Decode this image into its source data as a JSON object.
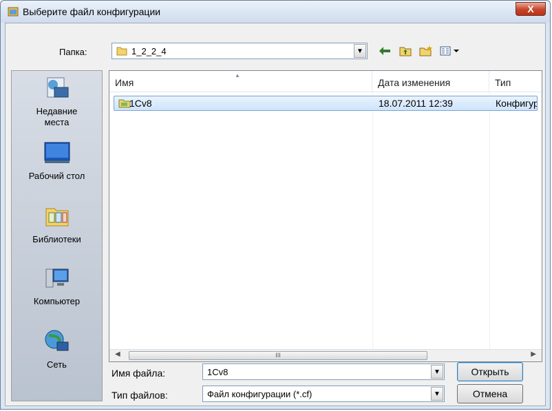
{
  "window": {
    "title": "Выберите файл конфигурации",
    "close_label": "X"
  },
  "folder": {
    "label": "Папка:",
    "label_access_key": "к",
    "value": "1_2_2_4"
  },
  "toolbar": [
    {
      "name": "back-icon",
      "glyph": "⇦"
    },
    {
      "name": "up-folder-icon",
      "glyph": "⤴"
    },
    {
      "name": "new-folder-icon",
      "glyph": "✱"
    },
    {
      "name": "view-menu-icon",
      "glyph": "▦▾"
    }
  ],
  "places": [
    {
      "id": "recent",
      "label": "Недавние места"
    },
    {
      "id": "desktop",
      "label": "Рабочий стол"
    },
    {
      "id": "libraries",
      "label": "Библиотеки"
    },
    {
      "id": "computer",
      "label": "Компьютер"
    },
    {
      "id": "network",
      "label": "Сеть"
    }
  ],
  "columns": [
    "Имя",
    "Дата изменения",
    "Тип"
  ],
  "files": [
    {
      "name": "1Cv8",
      "date": "18.07.2011 12:39",
      "type": "Конфигур"
    }
  ],
  "scrollbar": {
    "thumb_grip": "III"
  },
  "filename": {
    "label": "Имя файла:",
    "value": "1Cv8"
  },
  "filetype": {
    "label": "Тип файлов:",
    "value": "Файл конфигурации (*.cf)"
  },
  "buttons": {
    "open": "Открыть",
    "cancel": "Отмена"
  },
  "colors": {
    "selection": "#cde4fc",
    "selection_border": "#7da2ce",
    "window_frame": "#dbe6f3",
    "close_red": "#c8442b"
  }
}
